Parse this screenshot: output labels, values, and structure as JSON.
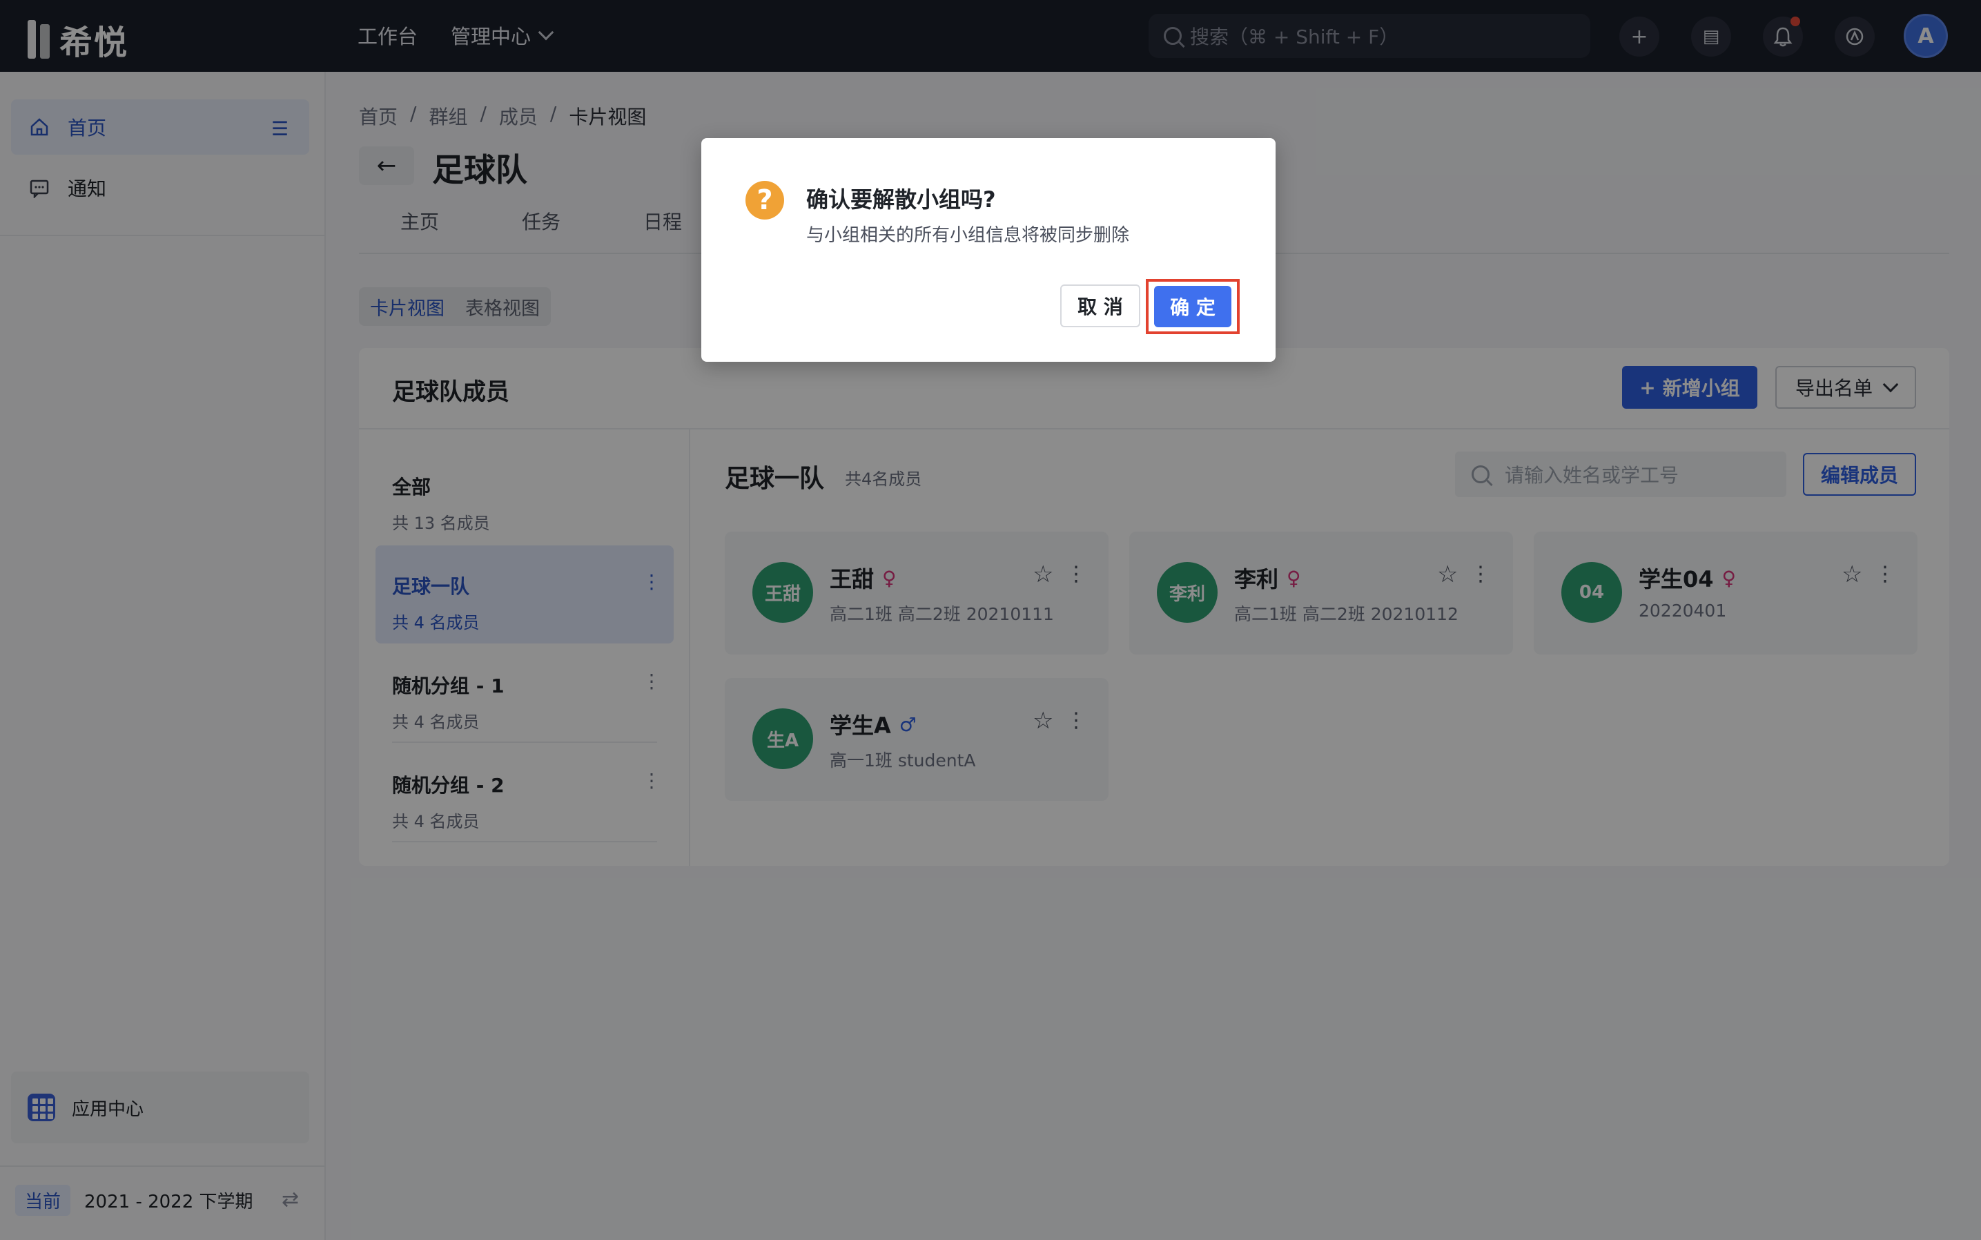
{
  "app": {
    "logo_text": "希悦",
    "nav": {
      "workbench": "工作台",
      "admin": "管理中心"
    },
    "search_placeholder": "搜索（⌘ + Shift + F）",
    "avatar_letter": "A",
    "icons": [
      "plus-icon",
      "chat-icon",
      "bell-icon",
      "settings-icon"
    ]
  },
  "sidebar": {
    "items": [
      {
        "label": "首页",
        "icon": "home-icon",
        "active": true
      },
      {
        "label": "通知",
        "icon": "message-icon",
        "active": false
      }
    ],
    "app_center": "应用中心",
    "term_badge": "当前",
    "term": "2021 - 2022 下学期"
  },
  "main": {
    "breadcrumb": [
      "首页",
      "群组",
      "成员",
      "卡片视图"
    ],
    "breadcrumb_sep": "/",
    "title": "足球队",
    "tabs": [
      "主页",
      "任务",
      "日程"
    ],
    "view_toggle": {
      "card": "卡片视图",
      "table": "表格视图"
    },
    "panel": {
      "title": "足球队成员",
      "add_group": "新增小组",
      "export": "导出名单",
      "groups": [
        {
          "name": "全部",
          "count": "共 13 名成员"
        },
        {
          "name": "足球一队",
          "count": "共 4 名成员"
        },
        {
          "name": "随机分组 - 1",
          "count": "共 4 名成员"
        },
        {
          "name": "随机分组 - 2",
          "count": "共 4 名成员"
        }
      ],
      "current_group": "足球一队",
      "current_count": "共4名成员",
      "member_search_placeholder": "请输入姓名或学工号",
      "edit_members": "编辑成员",
      "members": [
        {
          "avatar": "王甜",
          "name": "王甜",
          "gender": "♀",
          "info": "高二1班 高二2班 20210111"
        },
        {
          "avatar": "李利",
          "name": "李利",
          "gender": "♀",
          "info": "高二1班 高二2班 20210112"
        },
        {
          "avatar": "04",
          "name": "学生04",
          "gender": "♀",
          "info": "20220401"
        },
        {
          "avatar": "生A",
          "name": "学生A",
          "gender": "♂",
          "info": "高一1班 studentA"
        }
      ]
    }
  },
  "dialog": {
    "icon": "?",
    "title": "确认要解散小组吗?",
    "message": "与小组相关的所有小组信息将被同步删除",
    "cancel": "取 消",
    "confirm": "确 定"
  },
  "colors": {
    "primary": "#2f5fe0",
    "warning": "#f0a236",
    "highlight": "#e2422f",
    "avatar": "#2f9e72"
  }
}
